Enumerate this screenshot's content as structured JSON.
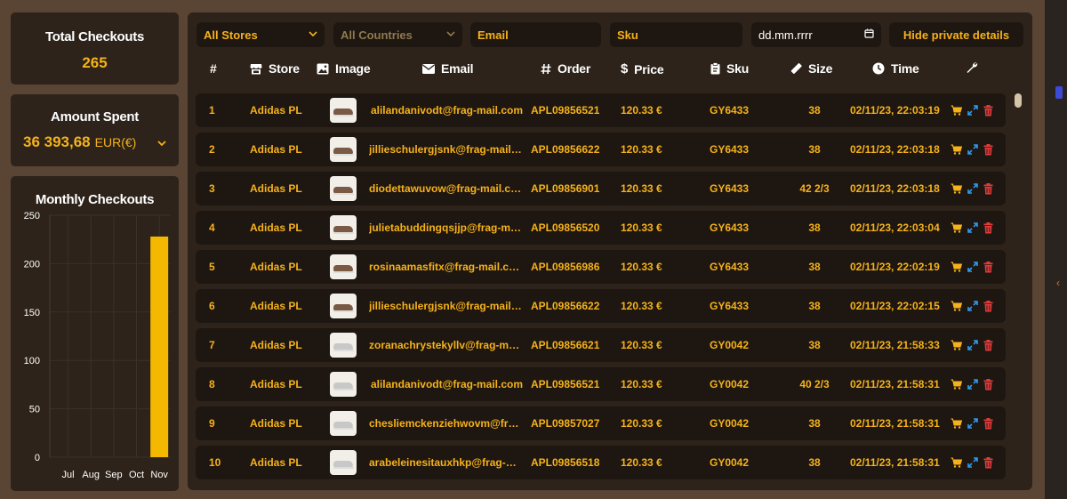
{
  "summary": {
    "total_checkouts_title": "Total Checkouts",
    "total_checkouts_value": "265",
    "amount_spent_title": "Amount Spent",
    "amount_spent_value": "36 393,68",
    "amount_spent_currency": "EUR(€)"
  },
  "chart_data": {
    "type": "bar",
    "title": "Monthly Checkouts",
    "categories": [
      "Jul",
      "Aug",
      "Sep",
      "Oct",
      "Nov"
    ],
    "values": [
      0,
      0,
      0,
      0,
      228
    ],
    "ylim": [
      0,
      250
    ],
    "yticks": [
      0,
      50,
      100,
      150,
      200,
      250
    ],
    "grid": true,
    "bar_color": "#f5b800"
  },
  "filters": {
    "store": "All Stores",
    "country": "All Countries",
    "email_placeholder": "Email",
    "sku_placeholder": "Sku",
    "date_placeholder": "dd.mm.rrrr",
    "hide_button": "Hide private details"
  },
  "columns": {
    "num": "#",
    "store": "Store",
    "image": "Image",
    "email": "Email",
    "order": "Order",
    "price": "Price",
    "sku": "Sku",
    "size": "Size",
    "time": "Time"
  },
  "icons": {
    "store": "store-icon",
    "image": "image-icon",
    "email": "envelope-icon",
    "order": "hash-icon",
    "price": "dollar-icon",
    "sku": "clipboard-icon",
    "size": "ruler-icon",
    "time": "clock-icon",
    "actions": "wrench-icon",
    "row_cart": "cart-icon",
    "row_expand": "expand-icon",
    "row_delete": "trash-icon"
  },
  "colors": {
    "accent": "#f5b21b",
    "cart": "#f5b21b",
    "expand": "#2f9bf0",
    "delete": "#e03c3c"
  },
  "rows": [
    {
      "num": "1",
      "store": "Adidas PL",
      "shoe": "brown",
      "email": "alilandanivodt@frag-mail.com",
      "order": "APL09856521",
      "price": "120.33 €",
      "sku": "GY6433",
      "size": "38",
      "time": "02/11/23, 22:03:19"
    },
    {
      "num": "2",
      "store": "Adidas PL",
      "shoe": "brown",
      "email": "jillieschulergjsnk@frag-mail.com",
      "order": "APL09856622",
      "price": "120.33 €",
      "sku": "GY6433",
      "size": "38",
      "time": "02/11/23, 22:03:18"
    },
    {
      "num": "3",
      "store": "Adidas PL",
      "shoe": "brown",
      "email": "diodettawuvow@frag-mail.com",
      "order": "APL09856901",
      "price": "120.33 €",
      "sku": "GY6433",
      "size": "42 2/3",
      "time": "02/11/23, 22:03:18"
    },
    {
      "num": "4",
      "store": "Adidas PL",
      "shoe": "brown",
      "email": "julietabuddingqsjjp@frag-mail.c...",
      "order": "APL09856520",
      "price": "120.33 €",
      "sku": "GY6433",
      "size": "38",
      "time": "02/11/23, 22:03:04"
    },
    {
      "num": "5",
      "store": "Adidas PL",
      "shoe": "brown",
      "email": "rosinaamasfitx@frag-mail.com",
      "order": "APL09856986",
      "price": "120.33 €",
      "sku": "GY6433",
      "size": "38",
      "time": "02/11/23, 22:02:19"
    },
    {
      "num": "6",
      "store": "Adidas PL",
      "shoe": "brown",
      "email": "jillieschulergjsnk@frag-mail.com",
      "order": "APL09856622",
      "price": "120.33 €",
      "sku": "GY6433",
      "size": "38",
      "time": "02/11/23, 22:02:15"
    },
    {
      "num": "7",
      "store": "Adidas PL",
      "shoe": "grey",
      "email": "zoranachrystekyllv@frag-mail.c...",
      "order": "APL09856621",
      "price": "120.33 €",
      "sku": "GY0042",
      "size": "38",
      "time": "02/11/23, 21:58:33"
    },
    {
      "num": "8",
      "store": "Adidas PL",
      "shoe": "grey",
      "email": "alilandanivodt@frag-mail.com",
      "order": "APL09856521",
      "price": "120.33 €",
      "sku": "GY0042",
      "size": "40 2/3",
      "time": "02/11/23, 21:58:31"
    },
    {
      "num": "9",
      "store": "Adidas PL",
      "shoe": "grey",
      "email": "chesliemckenziehwovm@frag-...",
      "order": "APL09857027",
      "price": "120.33 €",
      "sku": "GY0042",
      "size": "38",
      "time": "02/11/23, 21:58:31"
    },
    {
      "num": "10",
      "store": "Adidas PL",
      "shoe": "grey",
      "email": "arabeleinesitauxhkp@frag-mail....",
      "order": "APL09856518",
      "price": "120.33 €",
      "sku": "GY0042",
      "size": "38",
      "time": "02/11/23, 21:58:31"
    }
  ]
}
